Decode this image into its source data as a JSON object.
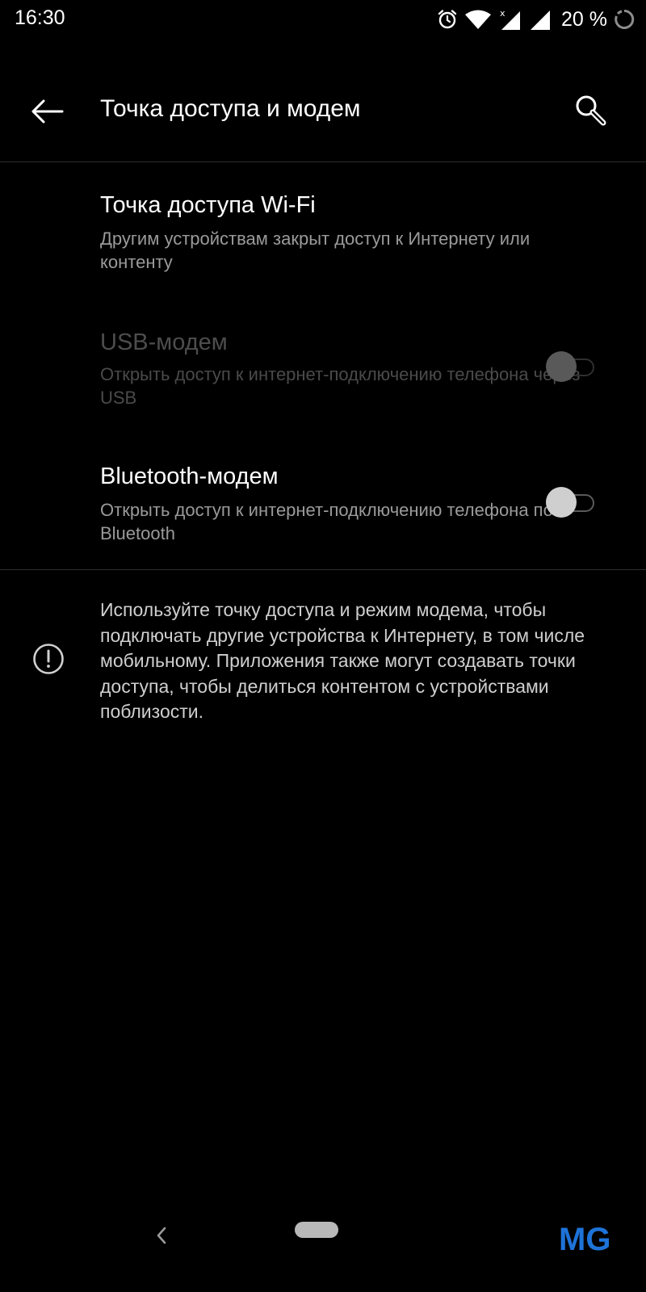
{
  "status_bar": {
    "time": "16:30",
    "battery_text": "20 %",
    "icons": [
      "alarm-icon",
      "wifi-icon",
      "cell-signal-nodata-icon",
      "cell-signal-icon",
      "battery-saver-icon"
    ]
  },
  "app_bar": {
    "title": "Точка доступа и модем",
    "back_icon": "arrow-left-icon",
    "search_icon": "search-icon"
  },
  "settings": [
    {
      "title": "Точка доступа Wi-Fi",
      "summary": "Другим устройствам закрыт доступ к Интернету или контенту",
      "has_toggle": false,
      "enabled": true
    },
    {
      "title": "USB-модем",
      "summary": "Открыть доступ к интернет-подключению телефона через USB",
      "has_toggle": true,
      "toggle_on": false,
      "enabled": false
    },
    {
      "title": "Bluetooth-модем",
      "summary": "Открыть доступ к интернет-подключению телефона по Bluetooth",
      "has_toggle": true,
      "toggle_on": false,
      "enabled": true
    }
  ],
  "info": {
    "icon": "info-exclamation-icon",
    "text": "Используйте точку доступа и режим модема, чтобы подключать другие устройства к Интернету, в том числе мобильному. Приложения также могут создавать точки доступа, чтобы делиться контентом с устройствами поблизости."
  },
  "nav_bar": {
    "back_icon": "chevron-left-icon",
    "home_icon": "home-pill-icon"
  },
  "watermark": {
    "text": "MG",
    "color": "#1e73d8"
  },
  "colors": {
    "background": "#000000",
    "primary_text": "#ffffff",
    "secondary_text": "#9a9a9a",
    "disabled_text": "#4d4d4d",
    "divider": "#2e2e2e"
  }
}
